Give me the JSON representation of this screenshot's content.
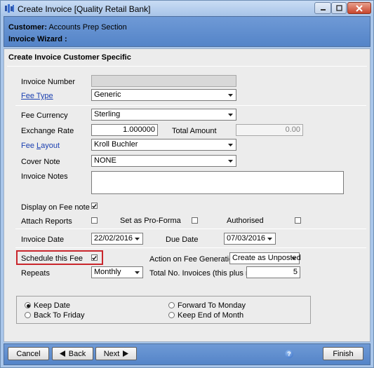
{
  "window": {
    "title": "Create Invoice [Quality Retail Bank]",
    "icon": "app-icon"
  },
  "header": {
    "customer_label": "Customer:",
    "customer_value": "Accounts Prep Section",
    "wizard_label": "Invoice Wizard :"
  },
  "section_title": "Create Invoice Customer Specific",
  "form": {
    "invoice_number": {
      "label": "Invoice Number",
      "value": ""
    },
    "fee_type": {
      "label": "Fee Type",
      "value": "Generic"
    },
    "fee_currency": {
      "label": "Fee Currency",
      "value": "Sterling"
    },
    "exchange_rate": {
      "label": "Exchange Rate",
      "value": "1.000000"
    },
    "total_amount": {
      "label": "Total Amount",
      "value": "0.00"
    },
    "fee_layout": {
      "label_a": "Fee ",
      "label_b": "L",
      "label_c": "ayout",
      "value": "Kroll Buchler"
    },
    "cover_note": {
      "label": "Cover Note",
      "value": "NONE"
    },
    "invoice_notes": {
      "label": "Invoice Notes",
      "value": ""
    },
    "display_on_fee_note": {
      "label": "Display on Fee note",
      "checked": true
    },
    "attach_reports": {
      "label": "Attach Reports",
      "checked": false
    },
    "set_as_pro_forma": {
      "label": "Set as Pro-Forma",
      "checked": false
    },
    "authorised": {
      "label": "Authorised",
      "checked": false
    },
    "invoice_date": {
      "label": "Invoice Date",
      "value": "22/02/2016"
    },
    "due_date": {
      "label": "Due Date",
      "value": "07/03/2016"
    },
    "schedule_this_fee": {
      "label": "Schedule this Fee",
      "checked": true
    },
    "action_on_fee_generation": {
      "label": "Action on Fee Generation",
      "value": "Create as Unposted"
    },
    "repeats": {
      "label": "Repeats",
      "value": "Monthly"
    },
    "total_no_invoices": {
      "label": "Total No. Invoices (this plus repeats)",
      "value": "5"
    }
  },
  "date_options": [
    {
      "label": "Keep Date",
      "selected": true
    },
    {
      "label": "Forward To Monday",
      "selected": false
    },
    {
      "label": "Back To Friday",
      "selected": false
    },
    {
      "label": "Keep End of Month",
      "selected": false
    }
  ],
  "footer": {
    "cancel": "Cancel",
    "back": "Back",
    "next": "Next",
    "finish": "Finish"
  },
  "colors": {
    "header_blue": "#5e8fd0",
    "link_blue": "#1a3fb0",
    "highlight_red": "#c9262c"
  }
}
